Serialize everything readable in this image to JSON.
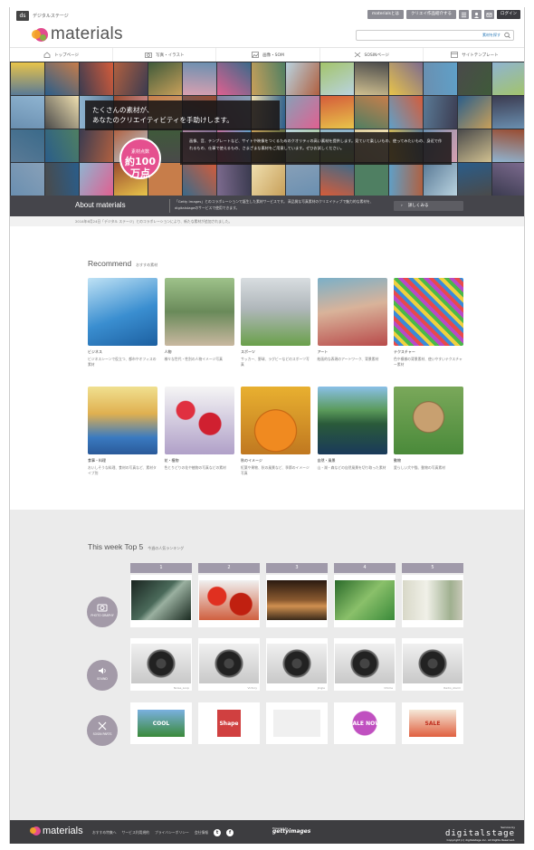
{
  "header": {
    "ds_logo": "ds",
    "ds_name": "デジタルステージ",
    "buttons": [
      "materialsとは",
      "クリエイ作品紹介する",
      "ログイン"
    ],
    "brand": "materials",
    "search_button": "素材を探す"
  },
  "nav": {
    "items": [
      {
        "label": "トップページ",
        "icon": "home-icon"
      },
      {
        "label": "写真・イラスト",
        "icon": "camera-icon"
      },
      {
        "label": "画像・SOM",
        "icon": "image-icon"
      },
      {
        "label": "SOSINページ",
        "icon": "scissors-icon"
      },
      {
        "label": "サイトテンプレート",
        "icon": "template-icon"
      }
    ]
  },
  "hero": {
    "tagline_line1": "たくさんの素材が、",
    "tagline_line2": "あなたのクリエイティビティを手助けします。",
    "description": "画像、音、テンプレートなど、サイトや映像をつくるためのクオリティの高い素材を提供します。見ていて楽しいもの、使ってみたいもの、身近で作れるもの、仕事で使えるもの、さまざまな素材をご用意しています。ぜひお試しください。",
    "badge_top": "素材点数",
    "badge_big": "約100万点",
    "colors": {
      "badge": "#e5508f",
      "dark": "#2e3238"
    }
  },
  "about": {
    "title": "About materials",
    "text": "「Getty Images」とのコラボレーションで誕生した素材サービスです。 高品質な写真素材のクリエイティブで魅力的な素材を、digitalstageのサービスで使用できます。",
    "button": "詳しくみる"
  },
  "notice": "2014年6月24日「デジタル ステージ」とのコラボレーションにより、新たな素材が追加されました。",
  "recommend": {
    "title": "Recommend",
    "subtitle": "おすすめ素材",
    "items": [
      {
        "category": "ビジネス",
        "text": "ビジネスシーンで役立つ、都市やオフィスの素材"
      },
      {
        "category": "人物",
        "text": "様々な世代・性別の人物イメージ写真"
      },
      {
        "category": "スポーツ",
        "text": "サッカー、野球、ラグビーなどのスポーツ写真"
      },
      {
        "category": "アート",
        "text": "絵画的な表現のアートワーク、背景素材"
      },
      {
        "category": "テクスチャー",
        "text": "色や模様の背景素材、使いやすいテクスチャー素材"
      },
      {
        "category": "食事・料理",
        "text": "おいしそうな料理、食材の写真など、素材タイプ別"
      },
      {
        "category": "花・植物",
        "text": "色とりどりの花や植物の写真などの素材"
      },
      {
        "category": "秋のイメージ",
        "text": "紅葉や果物、秋の風景など、季節のイメージ写真"
      },
      {
        "category": "自然・風景",
        "text": "山・湖・森などの自然風景を切り取った素材"
      },
      {
        "category": "動物",
        "text": "愛らしい犬や猫、動物の写真素材"
      }
    ]
  },
  "top5": {
    "title": "This week Top 5",
    "subtitle": "今週の人気ランキング",
    "ranks": [
      "1",
      "2",
      "3",
      "4",
      "5"
    ],
    "rows": [
      {
        "label": "PHOTO GRAPHY",
        "icon": "camera-icon"
      },
      {
        "label": "SOUND",
        "icon": "sound-icon"
      },
      {
        "label": "SOSIN PARTS",
        "icon": "scissors-icon"
      }
    ],
    "sound_captions": [
      "Noise_Loop",
      "Victory",
      "Jingle",
      "Chime",
      "Radio_Alarm"
    ],
    "part_texts": [
      "COOL",
      "Shape",
      "",
      "SALE NOW",
      "SALE"
    ]
  },
  "footer": {
    "brand": "materials",
    "links": [
      "おすすめ特集へ",
      "サービス利用規約",
      "プライバシーポリシー",
      "会社情報"
    ],
    "social": [
      "t",
      "f"
    ],
    "getty_small": "Powered by",
    "getty": "gettyimages",
    "ds_small": "Service by",
    "ds": "digitalstage",
    "copyright": "Copyright (c) digitalstage inc. All Rights Reserved."
  }
}
